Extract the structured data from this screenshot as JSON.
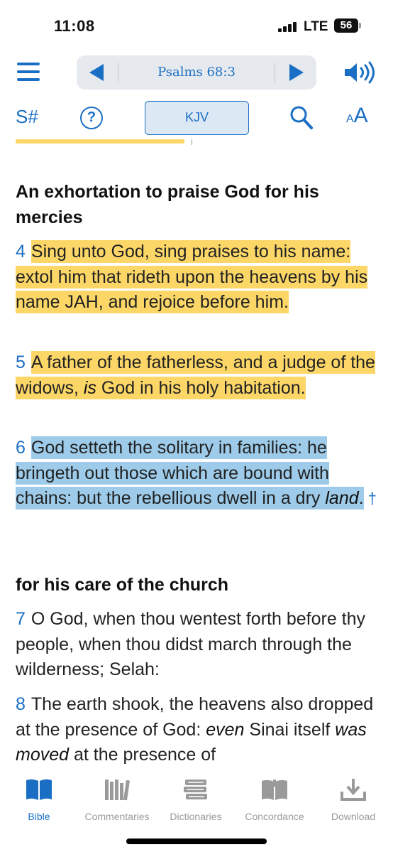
{
  "status": {
    "time": "11:08",
    "network": "LTE",
    "battery": "56"
  },
  "nav": {
    "reference": "Psalms 68:3"
  },
  "toolbar": {
    "strongs_label": "S#",
    "help_label": "?",
    "version": "KJV",
    "font_small": "A",
    "font_big": "A"
  },
  "passage": {
    "heading1": "An exhortation to praise God for his mercies",
    "verses": [
      {
        "num": "4",
        "text": "Sing unto God, sing praises to his name: extol him that rideth upon the heavens by his name JAH, and rejoice before him.",
        "highlight": "#fcd768"
      },
      {
        "num": "5",
        "part1": "A father of the fatherless, and a judge of the widows, ",
        "italic": "is",
        "part2": " God in his holy habitation.",
        "highlight": "#fcd768"
      },
      {
        "num": "6",
        "part1": "God setteth the solitary in families: he bringeth out those which are bound with chains: but the rebellious dwell in a dry ",
        "italic": "land",
        "part2": ".",
        "xref": "†",
        "highlight": "#9dcbe9"
      }
    ],
    "heading2": "for his care of the church",
    "verses2": [
      {
        "num": "7",
        "text": "O God, when thou wentest forth before thy people, when thou didst march through the wilderness; Selah:"
      },
      {
        "num": "8",
        "part1": "The earth shook, the heavens also dropped at the presence of God: ",
        "italic1": "even",
        "part2": " Sinai itself ",
        "italic2": "was moved",
        "part3": " at the presence of"
      }
    ]
  },
  "tabs": [
    {
      "label": "Bible",
      "icon": "bible-icon",
      "active": true
    },
    {
      "label": "Commentaries",
      "icon": "commentaries-icon",
      "active": false
    },
    {
      "label": "Dictionaries",
      "icon": "dictionaries-icon",
      "active": false
    },
    {
      "label": "Concordance",
      "icon": "concordance-icon",
      "active": false
    },
    {
      "label": "Download",
      "icon": "download-icon",
      "active": false
    }
  ],
  "colors": {
    "accent": "#1a6fc4",
    "highlight_yellow": "#fcd768",
    "highlight_blue": "#9dcbe9",
    "inactive": "#9a9a9a"
  }
}
